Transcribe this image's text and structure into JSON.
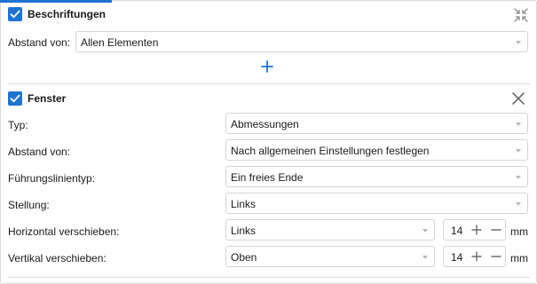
{
  "labels_section": {
    "title": "Beschriftungen",
    "checked": true,
    "collapse_icon": "collapse-arrows-icon",
    "distance_label": "Abstand von:",
    "distance_value": "Allen Elementen",
    "add_icon": "plus-icon"
  },
  "window_section": {
    "title": "Fenster",
    "checked": true,
    "close_icon": "close-x-icon",
    "fields": {
      "type_label": "Typ:",
      "type_value": "Abmessungen",
      "distance_label": "Abstand von:",
      "distance_value": "Nach allgemeinen Einstellungen festlegen",
      "leader_label": "Führungslinientyp:",
      "leader_value": "Ein freies Ende",
      "position_label": "Stellung:",
      "position_value": "Links",
      "horizontal_label": "Horizontal verschieben:",
      "horizontal_value": "Links",
      "horizontal_amount": "14",
      "vertical_label": "Vertikal verschieben:",
      "vertical_value": "Oben",
      "vertical_amount": "14",
      "unit": "mm"
    }
  },
  "colors": {
    "accent": "#1e73d2",
    "border": "#d4d4d4",
    "icon_gray": "#8a8a8a"
  }
}
